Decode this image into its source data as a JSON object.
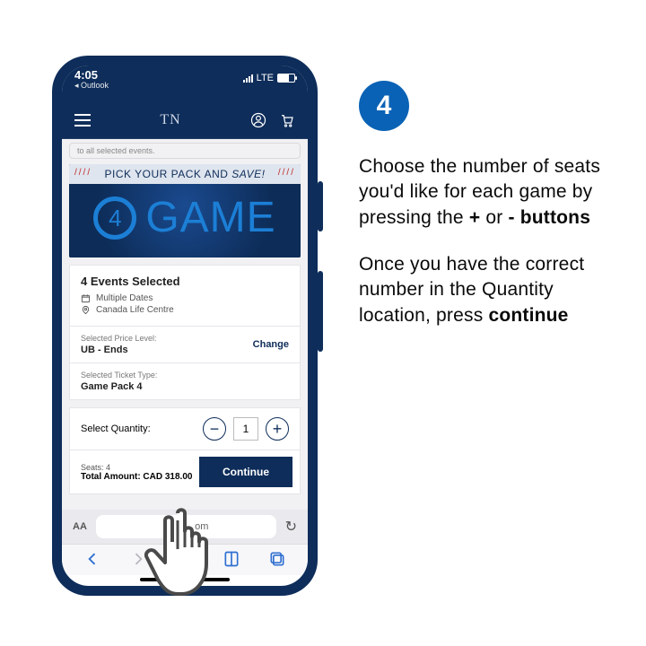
{
  "step": {
    "number": "4"
  },
  "instructions": {
    "para1_a": "Choose the number of seats you'd like for each game by pressing the ",
    "plus": "+",
    "para1_b": " or ",
    "minus": "-",
    "para1_c": " buttons",
    "para2_a": "Once you have the correct number in the Quantity location, press ",
    "continue_word": "continue"
  },
  "statusbar": {
    "time": "4:05",
    "back_app": "◂ Outlook",
    "network": "LTE"
  },
  "app": {
    "logo": "TN"
  },
  "snippet_text": "to all selected events.",
  "hero": {
    "strip_a": "PICK YOUR PACK AND ",
    "strip_b": "SAVE!",
    "badge_num": "4",
    "word": "GAME"
  },
  "events": {
    "title": "4 Events Selected",
    "dates": "Multiple Dates",
    "venue": "Canada Life Centre"
  },
  "price_level": {
    "label": "Selected Price Level:",
    "value": "UB - Ends",
    "change": "Change"
  },
  "ticket_type": {
    "label": "Selected Ticket Type:",
    "value": "Game Pack 4"
  },
  "quantity": {
    "label": "Select Quantity:",
    "value": "1"
  },
  "totals": {
    "seats_label": "Seats: 4",
    "amount_label": "Total Amount: CAD 318.00",
    "continue": "Continue"
  },
  "safari": {
    "aA": "AA",
    "host_suffix": "om",
    "reload": "↻"
  }
}
